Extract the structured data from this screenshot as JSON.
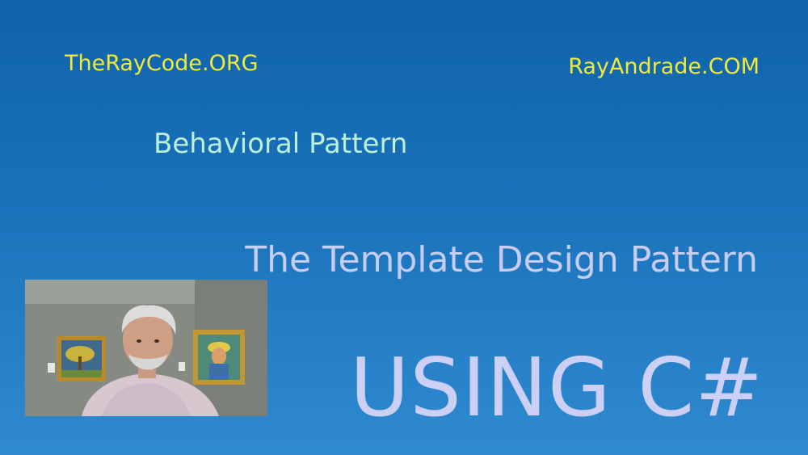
{
  "header": {
    "left_site": "TheRayCode.ORG",
    "right_site": "RayAndrade.COM"
  },
  "content": {
    "category": "Behavioral Pattern",
    "title": "The Template Design Pattern",
    "language": "USING C#"
  },
  "colors": {
    "background_top": "#0f63aa",
    "background_bottom": "#2f8ad0",
    "site_text": "#f2ea3a",
    "category_text": "#b9f0d6",
    "title_text": "#c6cdf0",
    "language_text": "#cdd0f6"
  },
  "webcam": {
    "icon": "presenter-webcam-image"
  }
}
